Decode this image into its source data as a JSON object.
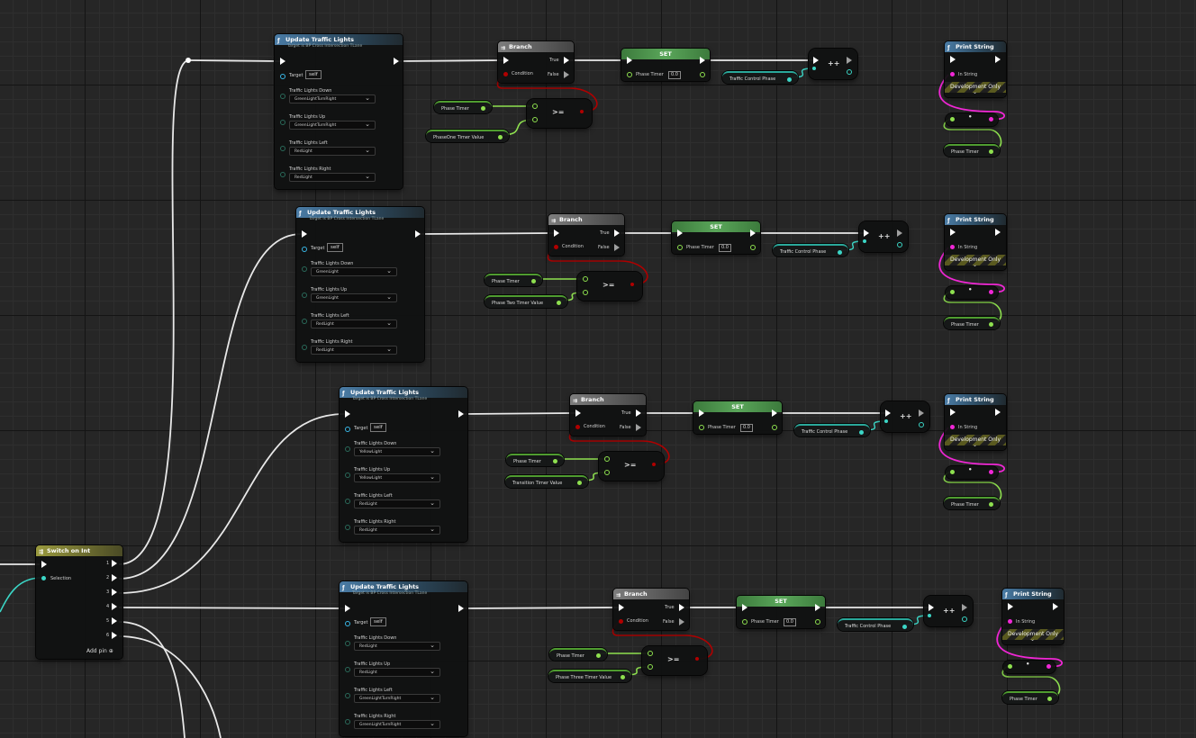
{
  "switch_node": {
    "title": "Switch on Int",
    "selection_label": "Selection",
    "outputs": [
      "1",
      "2",
      "3",
      "4",
      "5",
      "6"
    ],
    "add_pin_label": "Add pin"
  },
  "rows": [
    {
      "call": {
        "title": "Update Traffic Lights",
        "subtitle": "Target is BP Cross Intersection TLane",
        "target_label": "Target",
        "target_value": "self",
        "params": [
          {
            "label": "Traffic Lights Down",
            "value": "GreenLightTurnRight"
          },
          {
            "label": "Traffic Lights Up",
            "value": "GreenLightTurnRight"
          },
          {
            "label": "Traffic Lights Left",
            "value": "RedLight"
          },
          {
            "label": "Traffic Lights Right",
            "value": "RedLight"
          }
        ]
      },
      "branch": {
        "title": "Branch",
        "condition": "Condition",
        "true_label": "True",
        "false_label": "False"
      },
      "set": {
        "title": "SET",
        "var": "Phase Timer",
        "value": "0.0"
      },
      "increment": {
        "symbol": "++",
        "input": "Traffic Control Phase"
      },
      "compare": {
        "op": ">=",
        "a": "Phase Timer",
        "b": "PhaseOne Timer Value"
      },
      "print": {
        "title": "Print String",
        "in_string": "In String",
        "dev_only": "Development Only"
      },
      "reroute_var": "Phase Timer"
    },
    {
      "call": {
        "title": "Update Traffic Lights",
        "subtitle": "Target is BP Cross Intersection TLane",
        "target_label": "Target",
        "target_value": "self",
        "params": [
          {
            "label": "Traffic Lights Down",
            "value": "GreenLight"
          },
          {
            "label": "Traffic Lights Up",
            "value": "GreenLight"
          },
          {
            "label": "Traffic Lights Left",
            "value": "RedLight"
          },
          {
            "label": "Traffic Lights Right",
            "value": "RedLight"
          }
        ]
      },
      "branch": {
        "title": "Branch",
        "condition": "Condition",
        "true_label": "True",
        "false_label": "False"
      },
      "set": {
        "title": "SET",
        "var": "Phase Timer",
        "value": "0.0"
      },
      "increment": {
        "symbol": "++",
        "input": "Traffic Control Phase"
      },
      "compare": {
        "op": ">=",
        "a": "Phase Timer",
        "b": "Phase Two Timer Value"
      },
      "print": {
        "title": "Print String",
        "in_string": "In String",
        "dev_only": "Development Only"
      },
      "reroute_var": "Phase Timer"
    },
    {
      "call": {
        "title": "Update Traffic Lights",
        "subtitle": "Target is BP Cross Intersection TLane",
        "target_label": "Target",
        "target_value": "self",
        "params": [
          {
            "label": "Traffic Lights Down",
            "value": "YellowLight"
          },
          {
            "label": "Traffic Lights Up",
            "value": "YellowLight"
          },
          {
            "label": "Traffic Lights Left",
            "value": "RedLight"
          },
          {
            "label": "Traffic Lights Right",
            "value": "RedLight"
          }
        ]
      },
      "branch": {
        "title": "Branch",
        "condition": "Condition",
        "true_label": "True",
        "false_label": "False"
      },
      "set": {
        "title": "SET",
        "var": "Phase Timer",
        "value": "0.0"
      },
      "increment": {
        "symbol": "++",
        "input": "Traffic Control Phase"
      },
      "compare": {
        "op": ">=",
        "a": "Phase Timer",
        "b": "Transition Timer Value"
      },
      "print": {
        "title": "Print String",
        "in_string": "In String",
        "dev_only": "Development Only"
      },
      "reroute_var": "Phase Timer"
    },
    {
      "call": {
        "title": "Update Traffic Lights",
        "subtitle": "Target is BP Cross Intersection TLane",
        "target_label": "Target",
        "target_value": "self",
        "params": [
          {
            "label": "Traffic Lights Down",
            "value": "RedLight"
          },
          {
            "label": "Traffic Lights Up",
            "value": "RedLight"
          },
          {
            "label": "Traffic Lights Left",
            "value": "GreenLightTurnRight"
          },
          {
            "label": "Traffic Lights Right",
            "value": "GreenLightTurnRight"
          }
        ]
      },
      "branch": {
        "title": "Branch",
        "condition": "Condition",
        "true_label": "True",
        "false_label": "False"
      },
      "set": {
        "title": "SET",
        "var": "Phase Timer",
        "value": "0.0"
      },
      "increment": {
        "symbol": "++",
        "input": "Traffic Control Phase"
      },
      "compare": {
        "op": ">=",
        "a": "Phase Timer",
        "b": "Phase Three Timer Value"
      },
      "print": {
        "title": "Print String",
        "in_string": "In String",
        "dev_only": "Development Only"
      },
      "reroute_var": "Phase Timer"
    }
  ],
  "colors": {
    "exec_wire": "#e8e8e8",
    "float_wire": "#8ee04f",
    "bool_wire": "#b00000",
    "string_wire": "#f127d6",
    "int_wire": "#3bd6c6",
    "function_header": "#4a7ca6"
  },
  "icons": {
    "function": "function-icon",
    "branch": "branch-icon",
    "switch": "switch-icon",
    "add": "add-pin-icon"
  }
}
